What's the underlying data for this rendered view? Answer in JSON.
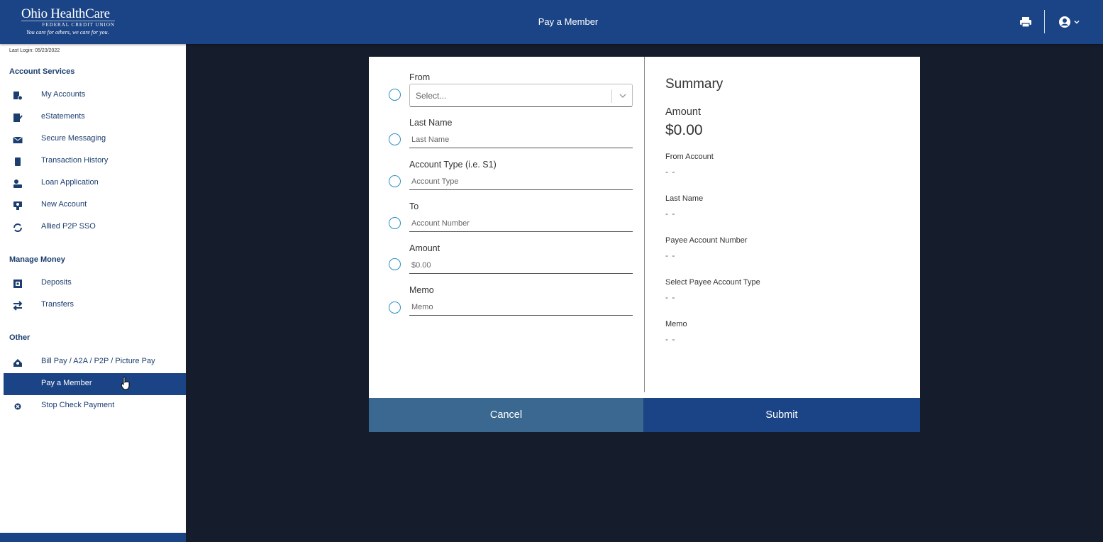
{
  "header": {
    "logo_main": "Ohio HealthCare",
    "logo_sub": "FEDERAL CREDIT UNION",
    "logo_tagline": "You care for others, we care for you.",
    "title": "Pay a Member",
    "brand_color": "#1b4486"
  },
  "sidebar": {
    "last_login": "Last Login: 05/23/2022",
    "sections": [
      {
        "title": "Account Services",
        "items": [
          {
            "label": "My Accounts",
            "icon": "accounts-icon"
          },
          {
            "label": "eStatements",
            "icon": "estatements-icon"
          },
          {
            "label": "Secure Messaging",
            "icon": "envelope-icon"
          },
          {
            "label": "Transaction History",
            "icon": "history-icon"
          },
          {
            "label": "Loan Application",
            "icon": "loan-icon"
          },
          {
            "label": "New Account",
            "icon": "new-account-icon"
          },
          {
            "label": "Allied P2P SSO",
            "icon": "sync-icon"
          }
        ]
      },
      {
        "title": "Manage Money",
        "items": [
          {
            "label": "Deposits",
            "icon": "deposit-icon"
          },
          {
            "label": "Transfers",
            "icon": "transfer-icon"
          }
        ]
      },
      {
        "title": "Other",
        "items": [
          {
            "label": "Bill Pay / A2A / P2P / Picture Pay",
            "icon": "billpay-icon"
          },
          {
            "label": "Pay a Member",
            "icon": "",
            "active": true
          },
          {
            "label": "Stop Check Payment",
            "icon": "stop-icon"
          }
        ]
      }
    ]
  },
  "form": {
    "from_label": "From",
    "from_placeholder": "Select...",
    "last_name_label": "Last Name",
    "last_name_placeholder": "Last Name",
    "account_type_label": "Account Type (i.e. S1)",
    "account_type_placeholder": "Account Type",
    "to_label": "To",
    "to_placeholder": "Account Number",
    "amount_label": "Amount",
    "amount_placeholder": "$0.00",
    "memo_label": "Memo",
    "memo_placeholder": "Memo"
  },
  "summary": {
    "title": "Summary",
    "amount_label": "Amount",
    "amount_value": "$0.00",
    "from_account_label": "From Account",
    "from_account_value": "- -",
    "last_name_label": "Last Name",
    "last_name_value": "- -",
    "payee_account_number_label": "Payee Account Number",
    "payee_account_number_value": "- -",
    "payee_account_type_label": "Select Payee Account Type",
    "payee_account_type_value": "- -",
    "memo_label": "Memo",
    "memo_value": "- -"
  },
  "actions": {
    "cancel_label": "Cancel",
    "submit_label": "Submit"
  }
}
